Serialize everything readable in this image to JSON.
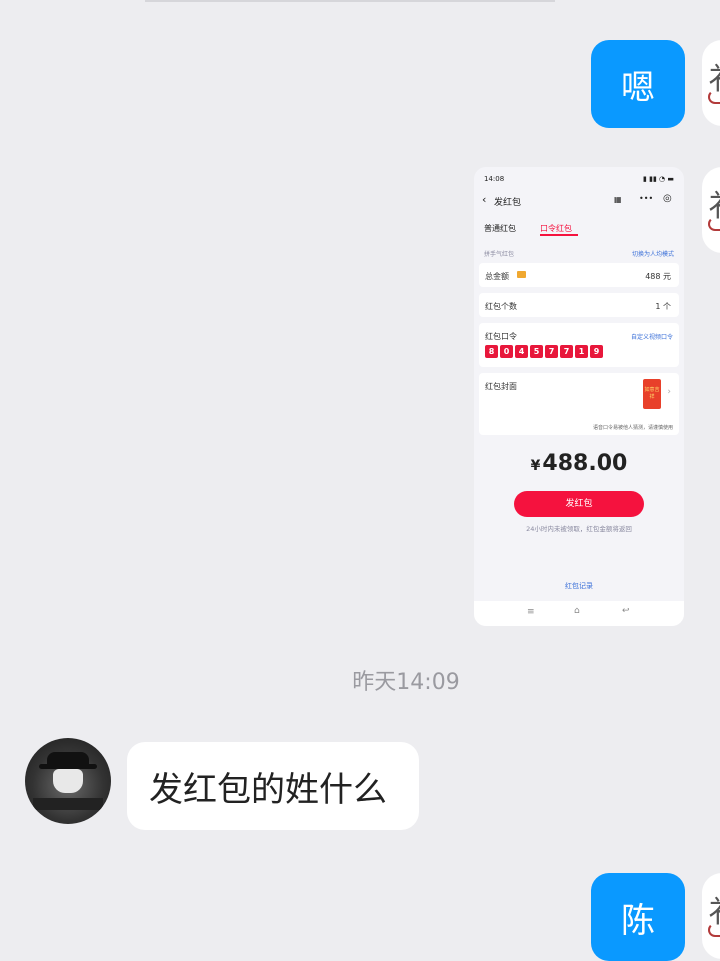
{
  "messages": {
    "msg1_text": "嗯",
    "timestamp": "昨天14:09",
    "msg2_text": "发红包的姓什么",
    "msg3_text": "陈"
  },
  "screenshot": {
    "status_time": "14:08",
    "title": "发红包",
    "tab_normal": "普通红包",
    "tab_password": "口令红包",
    "type_label": "拼手气红包",
    "switch_mode": "切换为人均模式",
    "total_label": "总金额",
    "total_value": "488 元",
    "count_label": "红包个数",
    "count_value": "1 个",
    "password_label": "红包口令",
    "password_action": "自定义视频口令",
    "password_digits": [
      "8",
      "0",
      "4",
      "5",
      "7",
      "7",
      "1",
      "9"
    ],
    "cover_label": "红包封面",
    "cover_text": "如意吉祥",
    "hint_text": "语音口令易被他人猜测，请谨慎使用",
    "amount_currency": "¥",
    "amount_value": "488.00",
    "send_button": "发红包",
    "note": "24小时内未被领取，红包金额将返回",
    "records": "红包记录"
  },
  "colors": {
    "bubble_blue": "#0a99ff",
    "background": "#ededf0",
    "red_accent": "#f5123e"
  },
  "icons": [
    "back-icon",
    "qr-icon",
    "more-icon",
    "target-icon",
    "menu-nav-icon",
    "home-nav-icon",
    "back-nav-icon",
    "chevron-right-icon",
    "hat-avatar-icon"
  ]
}
